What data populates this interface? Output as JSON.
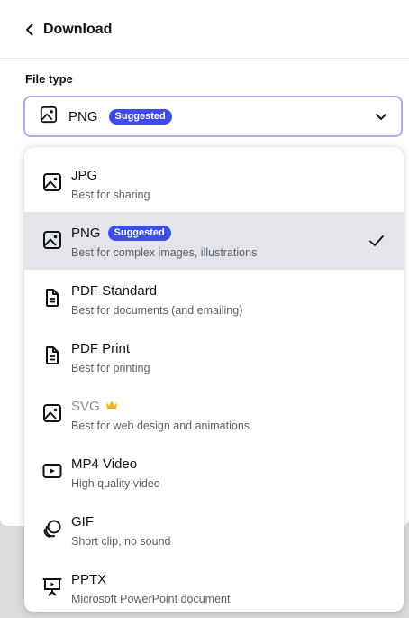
{
  "header": {
    "title": "Download"
  },
  "file_type": {
    "label": "File type",
    "selected_value": "PNG",
    "selected_badge": "Suggested"
  },
  "options": [
    {
      "title": "JPG",
      "description": "Best for sharing",
      "icon": "image-icon"
    },
    {
      "title": "PNG",
      "badge": "Suggested",
      "description": "Best for complex images, illustrations",
      "icon": "image-icon",
      "selected": true
    },
    {
      "title": "PDF Standard",
      "description": "Best for documents (and emailing)",
      "icon": "document-icon"
    },
    {
      "title": "PDF Print",
      "description": "Best for printing",
      "icon": "document-icon"
    },
    {
      "title": "SVG",
      "description": "Best for web design and animations",
      "icon": "image-icon",
      "premium": true
    },
    {
      "title": "MP4 Video",
      "description": "High quality video",
      "icon": "video-icon"
    },
    {
      "title": "GIF",
      "description": "Short clip, no sound",
      "icon": "gif-icon"
    },
    {
      "title": "PPTX",
      "description": "Microsoft PowerPoint document",
      "icon": "presentation-icon"
    }
  ],
  "colors": {
    "accent_badge": "#3c4de8",
    "select_border": "#b9a6f0",
    "selected_row": "#e3e5ea",
    "crown": "#f5b400"
  }
}
